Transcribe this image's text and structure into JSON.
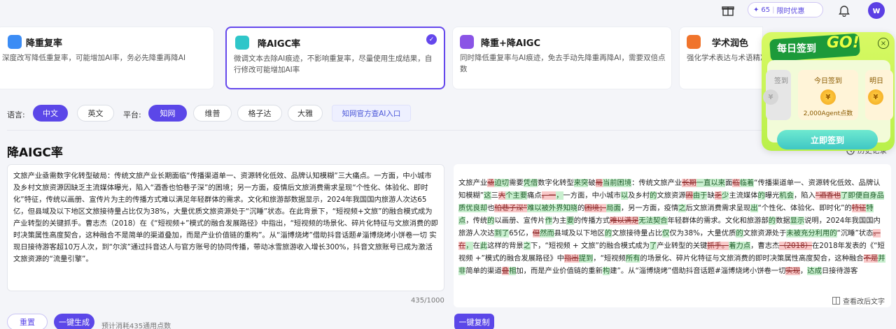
{
  "header": {
    "promo_points": "65",
    "promo_sep": "|",
    "promo_label": "限时优惠",
    "avatar_letter": "w"
  },
  "mode_cards": [
    {
      "title": "降重复率",
      "desc": "深度改写降低重复率，可能增加AI率，务必先降重再降AI",
      "icon_color": "#3b8cf5",
      "selected": false
    },
    {
      "title": "降AIGC率",
      "desc": "微调文本去除AI痕迹，不影响重复率，尽量使用生成结果，自行修改可能增加AI率",
      "icon_color": "#2fc6c9",
      "selected": true
    },
    {
      "title": "降重+降AIGC",
      "desc": "同时降低重复率与AI痕迹，免去手动先降重再降AI，需要双倍点数",
      "icon_color": "#8a54e6",
      "selected": false
    },
    {
      "title": "学术润色",
      "desc": "强化学术表达与术语精准，可能提升AI率",
      "icon_color": "#f0742c",
      "selected": false
    }
  ],
  "options": {
    "language_label": "语言:",
    "languages": [
      "中文",
      "英文"
    ],
    "platform_label": "平台:",
    "platforms": [
      "知网",
      "维普",
      "格子达",
      "大雅"
    ],
    "official_link": "知网官方查AI入口"
  },
  "page_title": "降AIGC率",
  "history_label": "历史记录",
  "input_text": "文旅产业亟需数字化转型破局：传统文旅产业长期面临“传播渠道单一、资源转化低效、品牌认知模糊”三大痛点。一方面，中小城市及乡村文旅资源因缺乏主流媒体曝光，陷入“酒香也怕巷子深”的困境；另一方面，疫情后文旅消费需求呈现“个性化、体验化、即时化”特征，传统以画册、宣传片为主的传播方式难以满足年轻群体的需求。文化和旅游部数据显示，2024年我国国内旅游人次达65亿，但县域及以下地区文旅接待量占比仅为38%，大量优质文旅资源处于“沉睡”状态。在此背景下，“短视频+文旅”的融合模式成为产业转型的关键抓手。曹志杰（2018）在《“短视频+”模式的融合发展路径》中指出，“短视频的场景化、碎片化特征与文旅消费的即时决策属性高度契合，这种融合不是简单的渠道叠加，而是产业价值链的重构”。从“淄博烧烤”借助抖音话题#淄博烧烤小饼卷一切 实现日接待游客超10万人次，到“尔滨”通过抖音达人与官方账号的协同传播，带动冰雪旅游收入增长300%，抖音文旅账号已成为激活文旅资源的“流量引擎”。",
  "char_count": "435/1000",
  "output_segments": [
    [
      "n",
      "文旅产业"
    ],
    [
      "d",
      "亟"
    ],
    [
      "a",
      "迫切"
    ],
    [
      "n",
      "需要"
    ],
    [
      "a",
      "凭借"
    ],
    [
      "n",
      "数字化转型"
    ],
    [
      "a",
      "来突"
    ],
    [
      "n",
      "破"
    ],
    [
      "d",
      "局"
    ],
    [
      "a",
      "当前困境"
    ],
    [
      "n",
      "：传统文旅产业"
    ],
    [
      "d",
      "长期"
    ],
    [
      "a",
      "一直以来"
    ],
    [
      "n",
      "面"
    ],
    [
      "d",
      "临"
    ],
    [
      "a",
      "临着"
    ],
    [
      "n",
      "“传播渠道单一、资源转化低效、品牌认知模糊”"
    ],
    [
      "a",
      "这"
    ],
    [
      "n",
      "三"
    ],
    [
      "d",
      "大"
    ],
    [
      "a",
      "个主要"
    ],
    [
      "n",
      "痛点"
    ],
    [
      "d",
      "。一"
    ],
    [
      "a",
      "，"
    ],
    [
      "n",
      "一方面，中小城市"
    ],
    [
      "a",
      "以"
    ],
    [
      "n",
      "及乡村"
    ],
    [
      "a",
      "的"
    ],
    [
      "n",
      "文旅资源"
    ],
    [
      "d",
      "因"
    ],
    [
      "a",
      "由于"
    ],
    [
      "n",
      "缺"
    ],
    [
      "d",
      "乏"
    ],
    [
      "a",
      "少"
    ],
    [
      "n",
      "主流媒体"
    ],
    [
      "a",
      "的"
    ],
    [
      "n",
      "曝光"
    ],
    [
      "a",
      "机会"
    ],
    [
      "n",
      "，陷入"
    ],
    [
      "d",
      "“酒香也"
    ],
    [
      "a",
      "了即便自身品质优良却"
    ],
    [
      "n",
      "也"
    ],
    [
      "d",
      "怕巷子深”"
    ],
    [
      "a",
      "难以被外界知晓"
    ],
    [
      "n",
      "的"
    ],
    [
      "d",
      "困境；"
    ],
    [
      "a",
      "局面"
    ],
    [
      "n",
      "，另一方面，疫情"
    ],
    [
      "a",
      "之"
    ],
    [
      "n",
      "后文旅消费需求呈现"
    ],
    [
      "a",
      "出"
    ],
    [
      "n",
      "“个性化、体验化、即时化”的"
    ],
    [
      "d",
      "特征"
    ],
    [
      "a",
      "特点"
    ],
    [
      "n",
      "，传统"
    ],
    [
      "a",
      "的"
    ],
    [
      "n",
      "以画册、宣传片"
    ],
    [
      "a",
      "作"
    ],
    [
      "n",
      "为主"
    ],
    [
      "a",
      "要"
    ],
    [
      "n",
      "的传播方式"
    ],
    [
      "d",
      "难以满足"
    ],
    [
      "a",
      "无法契合"
    ],
    [
      "n",
      "年轻群体的需求。文化和旅游部"
    ],
    [
      "a",
      "的"
    ],
    [
      "n",
      "数据"
    ],
    [
      "a",
      "显示"
    ],
    [
      "n",
      "说明，2024年我国国内旅游人次达"
    ],
    [
      "a",
      "到了"
    ],
    [
      "n",
      "65亿，"
    ],
    [
      "d",
      "但"
    ],
    [
      "a",
      "然而"
    ],
    [
      "n",
      "县域及以下地区"
    ],
    [
      "a",
      "的"
    ],
    [
      "n",
      "文旅接待量占比"
    ],
    [
      "a",
      "仅"
    ],
    [
      "n",
      "仅为38%，大量优质"
    ],
    [
      "a",
      "的"
    ],
    [
      "n",
      "文旅资源处于"
    ],
    [
      "a",
      "未被充分利用的"
    ],
    [
      "n",
      "“沉睡”状态"
    ],
    [
      "d",
      "。在"
    ],
    [
      "a",
      "，"
    ],
    [
      "n",
      "在"
    ],
    [
      "a",
      "此"
    ],
    [
      "n",
      "这样的背景"
    ],
    [
      "a",
      "之"
    ],
    [
      "n",
      "下，“短视频 + 文旅”的融合模式成为"
    ],
    [
      "a",
      "了"
    ],
    [
      "n",
      "产业转型的关键"
    ],
    [
      "d",
      "抓手。"
    ],
    [
      "a",
      "着力点"
    ],
    [
      "n",
      "，曹志杰"
    ],
    [
      "d",
      "（2018）"
    ],
    [
      "n",
      "在2018年发表的《“短视频 +”模式的融合发展路径》中"
    ],
    [
      "d",
      "指出"
    ],
    [
      "a",
      "提到"
    ],
    [
      "n",
      "，“短视频"
    ],
    [
      "a",
      "所有"
    ],
    [
      "n",
      "的场景化、碎片化特征与文旅消费的即时决策属性高度契合，这种融合"
    ],
    [
      "d",
      "不是"
    ],
    [
      "a",
      "并非"
    ],
    [
      "n",
      "简单的渠道"
    ],
    [
      "d",
      "叠"
    ],
    [
      "a",
      "相"
    ],
    [
      "n",
      "加，而是产业价值链的重新"
    ],
    [
      "a",
      "构"
    ],
    [
      "n",
      "建”。从“淄博烧烤”借助抖音话题#淄博烧烤小饼卷一切"
    ],
    [
      "d",
      "实现"
    ],
    [
      "n",
      "，"
    ],
    [
      "a",
      "达成"
    ],
    [
      "n",
      "日接待游客"
    ]
  ],
  "view_modified_label": "查看改后文字",
  "buttons": {
    "reset": "重置",
    "generate": "一键生成",
    "copy": "一键复制",
    "cost": "预计消耗435通用点数"
  },
  "checkin": {
    "title": "每日签到",
    "go": "GO!",
    "close": "×",
    "prev_label": "签到",
    "today_label": "今日签到",
    "next_label": "明日",
    "reward": "2,000Agent点数",
    "button": "立即签到"
  }
}
